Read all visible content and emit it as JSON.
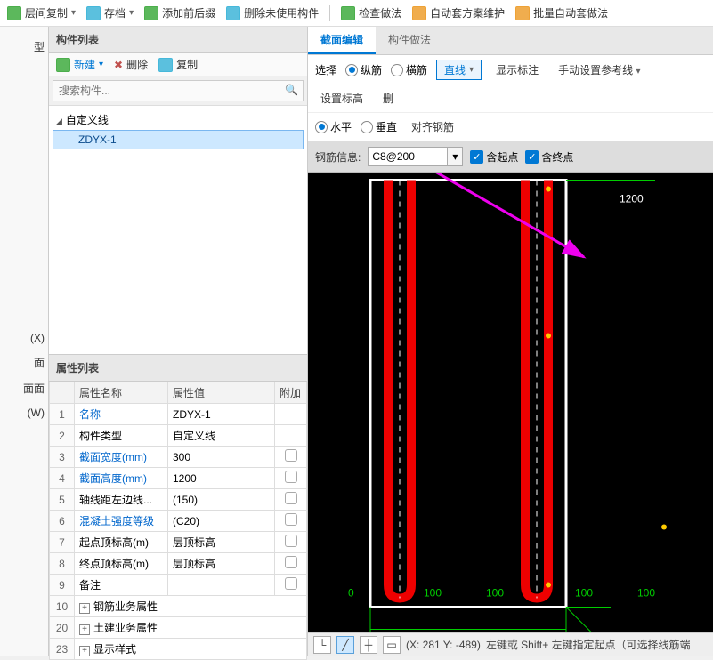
{
  "toolbar": {
    "layer_copy": "层间复制",
    "archive": "存档",
    "add_prefix": "添加前后缀",
    "del_unused": "删除未使用构件",
    "check_method": "检查做法",
    "auto_sleeve_maintain": "自动套方案维护",
    "batch_auto": "批量自动套做法"
  },
  "left_sidebar": {
    "row1": "型",
    "row2": "(X)",
    "row3": "面",
    "row4": "面面",
    "row5": "(W)"
  },
  "component_list": {
    "title": "构件列表",
    "new": "新建",
    "delete": "删除",
    "copy": "复制",
    "search_placeholder": "搜索构件...",
    "parent_node": "自定义线",
    "child_node": "ZDYX-1"
  },
  "prop_list": {
    "title": "属性列表",
    "col_name": "属性名称",
    "col_val": "属性值",
    "col_add": "附加",
    "rows": [
      {
        "idx": "1",
        "name": "名称",
        "val": "ZDYX-1",
        "link": true
      },
      {
        "idx": "2",
        "name": "构件类型",
        "val": "自定义线"
      },
      {
        "idx": "3",
        "name": "截面宽度(mm)",
        "val": "300",
        "link": true,
        "chk": true
      },
      {
        "idx": "4",
        "name": "截面高度(mm)",
        "val": "1200",
        "link": true,
        "chk": true
      },
      {
        "idx": "5",
        "name": "轴线距左边线...",
        "val": "(150)",
        "chk": true
      },
      {
        "idx": "6",
        "name": "混凝土强度等级",
        "val": "(C20)",
        "link": true,
        "chk": true
      },
      {
        "idx": "7",
        "name": "起点顶标高(m)",
        "val": "层顶标高",
        "chk": true
      },
      {
        "idx": "8",
        "name": "终点顶标高(m)",
        "val": "层顶标高",
        "chk": true
      },
      {
        "idx": "9",
        "name": "备注",
        "val": "",
        "chk": true
      },
      {
        "idx": "10",
        "name": "钢筋业务属性",
        "exp": true
      },
      {
        "idx": "20",
        "name": "土建业务属性",
        "exp": true
      },
      {
        "idx": "23",
        "name": "显示样式",
        "exp": true
      }
    ]
  },
  "right": {
    "tab_section": "截面编辑",
    "tab_method": "构件做法",
    "row1": {
      "select": "选择",
      "vbar": "纵筋",
      "hbar": "横筋",
      "line": "直线",
      "show_mark": "显示标注",
      "manual_ref": "手动设置参考线",
      "set_elev": "设置标高",
      "del": "删"
    },
    "row2": {
      "horizontal": "水平",
      "vertical": "垂直",
      "align_rebar": "对齐钢筋"
    },
    "info": {
      "label": "钢筋信息:",
      "value": "C8@200",
      "include_start": "含起点",
      "include_end": "含终点"
    },
    "canvas_label": "1200",
    "status": {
      "coords": "(X: 281 Y: -489)",
      "hint": "左键或 Shift+ 左键指定起点（可选择线筋端"
    }
  }
}
